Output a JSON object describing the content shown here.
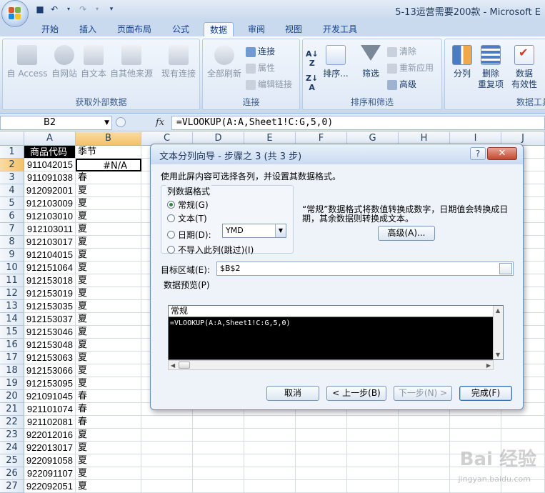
{
  "window": {
    "title": "5-13运营需要200款 - Microsoft E"
  },
  "colors": {
    "accent": "#15428b",
    "header_bg": "#000000"
  },
  "tabs": [
    "开始",
    "插入",
    "页面布局",
    "公式",
    "数据",
    "审阅",
    "视图",
    "开发工具"
  ],
  "ribbon": {
    "get_external": {
      "label": "获取外部数据",
      "buttons": [
        "自 Access",
        "自网站",
        "自文本",
        "自其他来源",
        "现有连接"
      ]
    },
    "connections": {
      "label": "连接",
      "refresh": "全部刷新",
      "items": [
        "连接",
        "属性",
        "编辑链接"
      ]
    },
    "sort_filter": {
      "label": "排序和筛选",
      "sort": "排序...",
      "filter": "筛选",
      "items": [
        "清除",
        "重新应用",
        "高级"
      ]
    },
    "data_tools": {
      "label": "数据工具",
      "split": "分列",
      "remove_dup_1": "删除",
      "remove_dup_2": "重复项",
      "validate_1": "数据",
      "validate_2": "有效性"
    }
  },
  "formula_bar": {
    "name_box": "B2",
    "fx": "fx",
    "formula": "=VLOOKUP(A:A,Sheet1!C:G,5,0)"
  },
  "grid": {
    "columns": [
      "A",
      "B",
      "C",
      "D",
      "E",
      "F",
      "G",
      "H",
      "I",
      "J"
    ],
    "rows": [
      {
        "n": "1",
        "a": "商品代码",
        "b": "季节"
      },
      {
        "n": "2",
        "a": "911042015",
        "b": "#N/A"
      },
      {
        "n": "3",
        "a": "911091038",
        "b": "春"
      },
      {
        "n": "4",
        "a": "912092001",
        "b": "夏"
      },
      {
        "n": "5",
        "a": "912103009",
        "b": "夏"
      },
      {
        "n": "6",
        "a": "912103010",
        "b": "夏"
      },
      {
        "n": "7",
        "a": "912103011",
        "b": "夏"
      },
      {
        "n": "8",
        "a": "912103017",
        "b": "夏"
      },
      {
        "n": "9",
        "a": "912104015",
        "b": "夏"
      },
      {
        "n": "10",
        "a": "912151064",
        "b": "夏"
      },
      {
        "n": "11",
        "a": "912153018",
        "b": "夏"
      },
      {
        "n": "12",
        "a": "912153019",
        "b": "夏"
      },
      {
        "n": "13",
        "a": "912153035",
        "b": "夏"
      },
      {
        "n": "14",
        "a": "912153037",
        "b": "夏"
      },
      {
        "n": "15",
        "a": "912153046",
        "b": "夏"
      },
      {
        "n": "16",
        "a": "912153048",
        "b": "夏"
      },
      {
        "n": "17",
        "a": "912153063",
        "b": "夏"
      },
      {
        "n": "18",
        "a": "912153066",
        "b": "夏"
      },
      {
        "n": "19",
        "a": "912153095",
        "b": "夏"
      },
      {
        "n": "20",
        "a": "921091045",
        "b": "春"
      },
      {
        "n": "21",
        "a": "921101074",
        "b": "春"
      },
      {
        "n": "22",
        "a": "921102081",
        "b": "春"
      },
      {
        "n": "23",
        "a": "922012016",
        "b": "夏"
      },
      {
        "n": "24",
        "a": "922013017",
        "b": "夏"
      },
      {
        "n": "25",
        "a": "922091058",
        "b": "夏"
      },
      {
        "n": "26",
        "a": "922091107",
        "b": "夏"
      },
      {
        "n": "27",
        "a": "922092051",
        "b": "夏"
      }
    ]
  },
  "dialog": {
    "title": "文本分列向导 - 步骤之 3 (共 3 步)",
    "help": "?",
    "close": "✕",
    "instruction": "使用此屏内容可选择各列，并设置其数据格式。",
    "format_group": "列数据格式",
    "options": [
      "常规(G)",
      "文本(T)",
      "日期(D):",
      "不导入此列(跳过)(I)"
    ],
    "selected_option": 0,
    "date_format": "YMD",
    "description": "“常规”数据格式将数值转换成数字，日期值会转换成日期，其余数据则转换成文本。",
    "advanced_button": "高级(A)...",
    "target_label": "目标区域(E):",
    "target_value": "$B$2",
    "preview_label": "数据预览(P)",
    "preview_header": "常规",
    "preview_row": "=VLOOKUP(A:A,Sheet1!C:G,5,0)",
    "buttons": {
      "cancel": "取消",
      "back": "< 上一步(B)",
      "next": "下一步(N) >",
      "finish": "完成(F)"
    }
  },
  "watermark": {
    "text": "Bai 经验",
    "sub": "jingyan.baidu.com"
  }
}
